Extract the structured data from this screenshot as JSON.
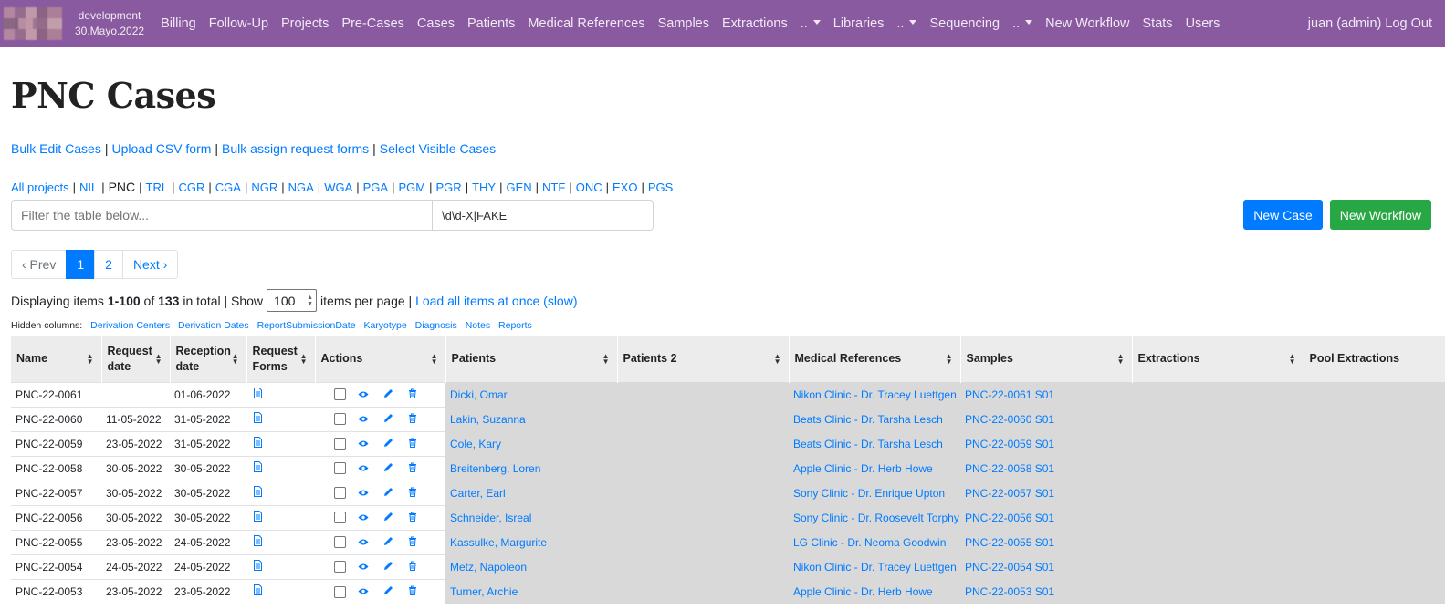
{
  "navbar": {
    "env_line1": "development",
    "env_line2": "30.Mayo.2022",
    "items": [
      "Billing",
      "Follow-Up",
      "Projects",
      "Pre-Cases",
      "Cases",
      "Patients",
      "Medical References",
      "Samples",
      "Extractions",
      "..",
      "Libraries",
      "..",
      "Sequencing",
      "..",
      "New Workflow",
      "Stats",
      "Users"
    ],
    "user": "juan (admin) Log Out"
  },
  "page_title": "PNC Cases",
  "bulk_links": [
    "Bulk Edit Cases",
    "Upload CSV form",
    "Bulk assign request forms",
    "Select Visible Cases"
  ],
  "projects": {
    "all": "All projects",
    "current": "PNC",
    "list": [
      "NIL",
      "TRL",
      "CGR",
      "CGA",
      "NGR",
      "NGA",
      "WGA",
      "PGA",
      "PGM",
      "PGR",
      "THY",
      "GEN",
      "NTF",
      "ONC",
      "EXO",
      "PGS"
    ]
  },
  "filter": {
    "placeholder": "Filter the table below...",
    "regex_value": "\\d\\d-X|FAKE"
  },
  "buttons": {
    "new_case": "New Case",
    "new_workflow": "New Workflow"
  },
  "pagination": {
    "prev": "‹ Prev",
    "pages": [
      "1",
      "2"
    ],
    "next": "Next ›"
  },
  "display": {
    "prefix": "Displaying items",
    "range": "1-100",
    "of": "of",
    "total": "133",
    "suffix": "in total | Show",
    "per_page": "100",
    "per_page_suffix": "items per page |",
    "load_all": "Load all items at once (slow)"
  },
  "hidden_columns": {
    "label": "Hidden columns:",
    "items": [
      "Derivation Centers",
      "Derivation Dates",
      "ReportSubmissionDate",
      "Karyotype",
      "Diagnosis",
      "Notes",
      "Reports"
    ]
  },
  "table": {
    "headers": [
      "Name",
      "Request date",
      "Reception date",
      "Request Forms",
      "Actions",
      "Patients",
      "Patients 2",
      "Medical References",
      "Samples",
      "Extractions",
      "Pool Extractions"
    ],
    "rows": [
      {
        "name": "PNC-22-0061",
        "request": "",
        "reception": "01-06-2022",
        "patient": "Dicki, Omar",
        "patient2": "",
        "medref": "Nikon Clinic - Dr. Tracey Luettgen",
        "sample": "PNC-22-0061 S01"
      },
      {
        "name": "PNC-22-0060",
        "request": "11-05-2022",
        "reception": "31-05-2022",
        "patient": "Lakin, Suzanna",
        "patient2": "",
        "medref": "Beats Clinic - Dr. Tarsha Lesch",
        "sample": "PNC-22-0060 S01"
      },
      {
        "name": "PNC-22-0059",
        "request": "23-05-2022",
        "reception": "31-05-2022",
        "patient": "Cole, Kary",
        "patient2": "",
        "medref": "Beats Clinic - Dr. Tarsha Lesch",
        "sample": "PNC-22-0059 S01"
      },
      {
        "name": "PNC-22-0058",
        "request": "30-05-2022",
        "reception": "30-05-2022",
        "patient": "Breitenberg, Loren",
        "patient2": "",
        "medref": "Apple Clinic - Dr. Herb Howe",
        "sample": "PNC-22-0058 S01"
      },
      {
        "name": "PNC-22-0057",
        "request": "30-05-2022",
        "reception": "30-05-2022",
        "patient": "Carter, Earl",
        "patient2": "",
        "medref": "Sony Clinic - Dr. Enrique Upton",
        "sample": "PNC-22-0057 S01"
      },
      {
        "name": "PNC-22-0056",
        "request": "30-05-2022",
        "reception": "30-05-2022",
        "patient": "Schneider, Isreal",
        "patient2": "",
        "medref": "Sony Clinic - Dr. Roosevelt Torphy",
        "sample": "PNC-22-0056 S01"
      },
      {
        "name": "PNC-22-0055",
        "request": "23-05-2022",
        "reception": "24-05-2022",
        "patient": "Kassulke, Margurite",
        "patient2": "",
        "medref": "LG Clinic - Dr. Neoma Goodwin",
        "sample": "PNC-22-0055 S01"
      },
      {
        "name": "PNC-22-0054",
        "request": "24-05-2022",
        "reception": "24-05-2022",
        "patient": "Metz, Napoleon",
        "patient2": "",
        "medref": "Nikon Clinic - Dr. Tracey Luettgen",
        "sample": "PNC-22-0054 S01"
      },
      {
        "name": "PNC-22-0053",
        "request": "23-05-2022",
        "reception": "23-05-2022",
        "patient": "Turner, Archie",
        "patient2": "",
        "medref": "Apple Clinic - Dr. Herb Howe",
        "sample": "PNC-22-0053 S01"
      }
    ]
  },
  "colors": {
    "navbar": "#8a5aa0",
    "link": "#007bff",
    "primary": "#007bff",
    "success": "#28a745",
    "grey_cell": "#d9d9d9"
  }
}
